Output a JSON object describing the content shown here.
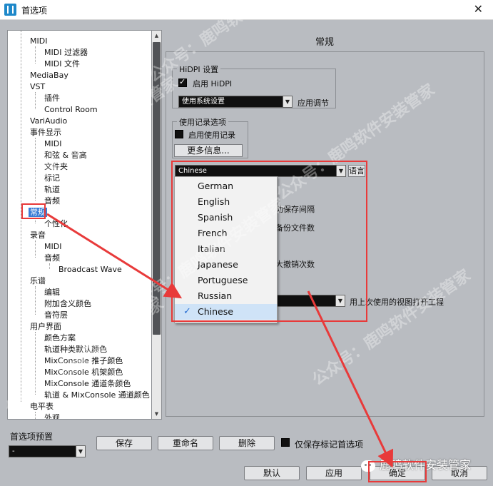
{
  "window": {
    "title": "首选项",
    "close_glyph": "✕"
  },
  "tree": {
    "items": [
      {
        "label": "MIDI",
        "level": 1
      },
      {
        "label": "MIDI 过滤器",
        "level": 2
      },
      {
        "label": "MIDI 文件",
        "level": 2
      },
      {
        "label": "MediaBay",
        "level": 1
      },
      {
        "label": "VST",
        "level": 1
      },
      {
        "label": "插件",
        "level": 2
      },
      {
        "label": "Control Room",
        "level": 2
      },
      {
        "label": "VariAudio",
        "level": 1
      },
      {
        "label": "事件显示",
        "level": 1
      },
      {
        "label": "MIDI",
        "level": 2
      },
      {
        "label": "和弦 & 音高",
        "level": 2
      },
      {
        "label": "文件夹",
        "level": 2
      },
      {
        "label": "标记",
        "level": 2
      },
      {
        "label": "轨道",
        "level": 2
      },
      {
        "label": "音频",
        "level": 2
      },
      {
        "label": "常规",
        "level": 1,
        "selected": true
      },
      {
        "label": "个性化",
        "level": 2
      },
      {
        "label": "录音",
        "level": 1
      },
      {
        "label": "MIDI",
        "level": 2
      },
      {
        "label": "音频",
        "level": 2
      },
      {
        "label": "Broadcast Wave",
        "level": 3
      },
      {
        "label": "乐谱",
        "level": 1
      },
      {
        "label": "编辑",
        "level": 2
      },
      {
        "label": "附加含义颜色",
        "level": 2
      },
      {
        "label": "音符层",
        "level": 2
      },
      {
        "label": "用户界面",
        "level": 1
      },
      {
        "label": "颜色方案",
        "level": 2
      },
      {
        "label": "轨道种类默认颜色",
        "level": 2
      },
      {
        "label": "MixConsole 推子颜色",
        "level": 2
      },
      {
        "label": "MixConsole 机架颜色",
        "level": 2
      },
      {
        "label": "MixConsole 通道条颜色",
        "level": 2
      },
      {
        "label": "轨道 & MixConsole 通道颜色",
        "level": 2
      },
      {
        "label": "电平表",
        "level": 1
      },
      {
        "label": "外观",
        "level": 2
      }
    ]
  },
  "main": {
    "section_title": "常规",
    "hidpi": {
      "group_label": "HiDPI 设置",
      "enable_label": "启用 HiDPI",
      "enabled": true,
      "scaling_value": "使用系统设置",
      "app_adjust_label": "应用调节"
    },
    "usage": {
      "group_label": "使用记录选项",
      "enable_label": "启用使用记录",
      "enabled": false,
      "more_info_button": "更多信息..."
    },
    "language": {
      "value": "Chinese",
      "button_label": "语言",
      "options": [
        "German",
        "English",
        "Spanish",
        "French",
        "Italian",
        "Japanese",
        "Portuguese",
        "Russian",
        "Chinese"
      ],
      "selected": "Chinese",
      "check_glyph": "✓"
    },
    "hidden_rows": {
      "autosave_interval": "动保存间隔",
      "backup_count": "备份文件数",
      "undo_count": "大撤销次数",
      "open_project_view": "用上次使用的视图打开工程"
    },
    "dropdown_arrow": "▼"
  },
  "bottom": {
    "preset_label": "首选项预置",
    "preset_value": "-",
    "save_button": "保存",
    "rename_button": "重命名",
    "delete_button": "删除",
    "only_marked_label": "仅保存标记首选项",
    "only_marked": false,
    "default_button": "默认",
    "apply_button": "应用",
    "ok_button": "确定",
    "cancel_button": "取消"
  },
  "watermark": {
    "text": "公众号：鹿鸣软件安装管家",
    "logo_text": "鹿鸣软件安装管家"
  },
  "colors": {
    "annotation_red": "#e83a3a",
    "selection_blue": "#3a7dd6",
    "panel_gray": "#b9bcc1"
  }
}
